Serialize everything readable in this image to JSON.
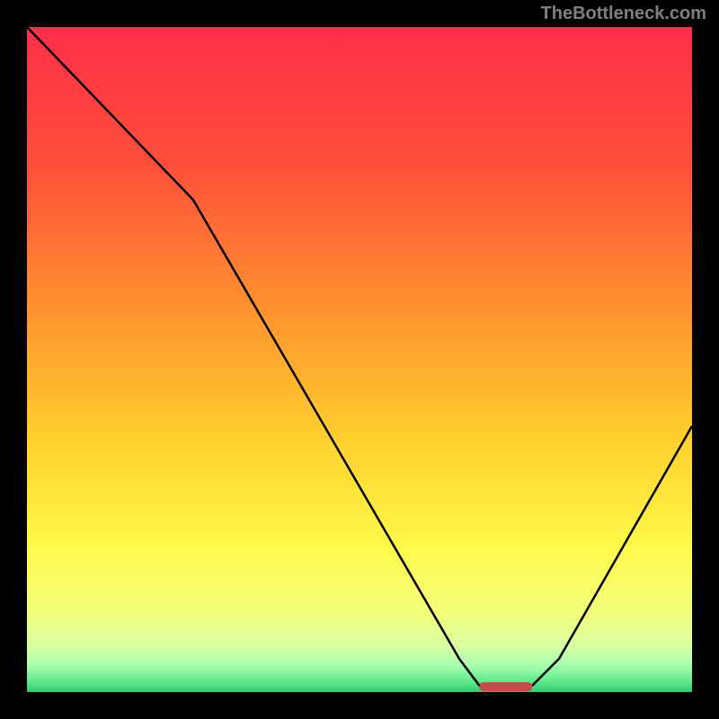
{
  "watermark": "TheBottleneck.com",
  "chart_data": {
    "type": "line",
    "title": "",
    "xlabel": "",
    "ylabel": "",
    "xlim": [
      0,
      100
    ],
    "ylim": [
      0,
      100
    ],
    "gradient_stops": [
      {
        "offset": 0,
        "color": "#FF2E4A"
      },
      {
        "offset": 20,
        "color": "#FF4D3A"
      },
      {
        "offset": 45,
        "color": "#FF9A2E"
      },
      {
        "offset": 62,
        "color": "#FFCF2E"
      },
      {
        "offset": 78,
        "color": "#FFF94A"
      },
      {
        "offset": 88,
        "color": "#F4FF7A"
      },
      {
        "offset": 93,
        "color": "#D8FFA0"
      },
      {
        "offset": 96,
        "color": "#A8FFB0"
      },
      {
        "offset": 98.5,
        "color": "#5CE88C"
      },
      {
        "offset": 100,
        "color": "#2ECC71"
      }
    ],
    "series": [
      {
        "name": "bottleneck-curve",
        "x": [
          0,
          25,
          65,
          68,
          76,
          80,
          100
        ],
        "y": [
          100,
          74,
          5,
          1,
          1,
          5,
          40
        ]
      }
    ],
    "marker": {
      "name": "optimal-zone",
      "x_center": 72,
      "y": 0.8,
      "width": 8,
      "color": "#C84B4B"
    }
  }
}
